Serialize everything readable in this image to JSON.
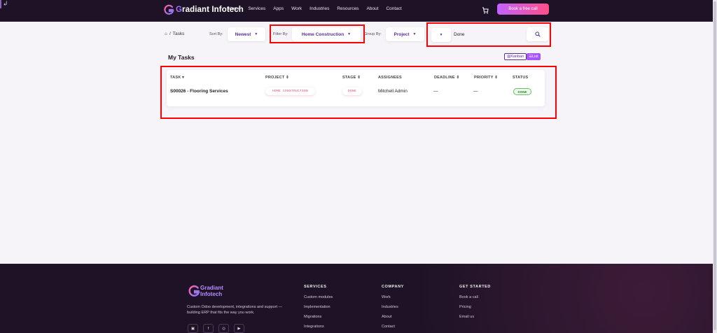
{
  "corner_glyph": "↲",
  "nav": {
    "brand": {
      "initial": "G",
      "rest": "radiant Infotech"
    },
    "links": [
      "Home",
      "Services",
      "Apps",
      "Work",
      "Industries",
      "Resources",
      "About",
      "Contact"
    ],
    "cta": "Book a free call"
  },
  "breadcrumb": {
    "home_glyph": "⌂",
    "separator": "/",
    "current": "Tasks"
  },
  "filters": {
    "sort_label": "Sort By:",
    "sort_value": "Newest",
    "filter_label": "Filter By:",
    "filter_value": "Home Construction",
    "group_label": "Group By:",
    "group_value": "Project",
    "search_scope": "",
    "search_value": "Done"
  },
  "tasks": {
    "title": "My Tasks",
    "view_kanban": "Kanban",
    "view_list": "List",
    "columns": {
      "task": "TASK ▾",
      "project": "PROJECT ⇕",
      "stage": "STAGE ⇕",
      "assignees": "ASSIGNEES",
      "deadline": "DEADLINE ⇕",
      "priority": "PRIORITY ⇕",
      "status": "STATUS"
    },
    "rows": [
      {
        "task": "S00026 - Flooring Services",
        "project": "HOME CONSTRUCTION",
        "stage": "DONE",
        "assignees": "Mitchell Admin",
        "deadline": "—",
        "priority": "—",
        "status": "DONE"
      }
    ]
  },
  "footer": {
    "brand_line1": "Gradiant",
    "brand_line2": "Infotech",
    "description": "Custom Odoo development, integrations and support — building ERP that fits the way you work.",
    "columns": [
      {
        "heading": "SERVICES",
        "items": [
          "Custom modules",
          "Implementation",
          "Migrations",
          "Integrations"
        ]
      },
      {
        "heading": "COMPANY",
        "items": [
          "Work",
          "Industries",
          "About",
          "Contact"
        ]
      },
      {
        "heading": "GET STARTED",
        "items": [
          "Book a call",
          "Pricing",
          "Email us"
        ]
      }
    ]
  },
  "colors": {
    "accent": "#5a2f94",
    "cta_start": "#c163ff",
    "cta_end": "#ff4e8a",
    "nav_bg": "#1e1326",
    "highlight": "#ff0000"
  }
}
